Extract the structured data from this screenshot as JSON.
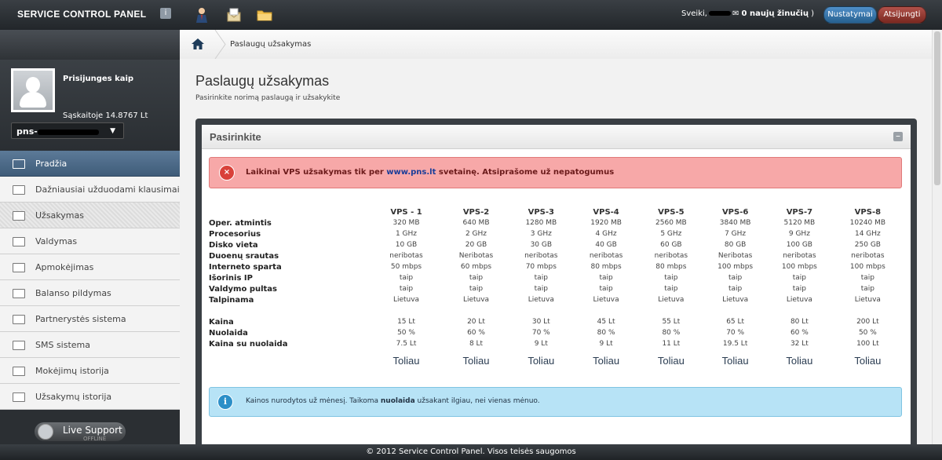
{
  "topbar": {
    "brand": "SERVICE CONTROL PANEL",
    "brand_badge": "i",
    "icons": [
      "user-icon",
      "mail-icon",
      "folder-icon"
    ],
    "greeting_prefix": "Sveiki,",
    "messages_count": "0 naujų žinučių",
    "messages_suffix": ")",
    "settings_label": "Nustatymai",
    "logout_label": "Atsijungti"
  },
  "profile": {
    "logged_as": "Prisijunges kaip",
    "balance": "Sąskaitoje 14.8767 Lt",
    "account_prefix": "pns-"
  },
  "sidebar": {
    "items": [
      {
        "label": "Pradžia",
        "active": true
      },
      {
        "label": "Dažniausiai užduodami klausimai"
      },
      {
        "label": "Užsakymas",
        "hover": true
      },
      {
        "label": "Valdymas"
      },
      {
        "label": "Apmokėjimas"
      },
      {
        "label": "Balanso pildymas"
      },
      {
        "label": "Partnerystės sistema"
      },
      {
        "label": "SMS sistema"
      },
      {
        "label": "Mokėjimų istorija"
      },
      {
        "label": "Užsakymų istorija"
      }
    ],
    "live_support": "Live Support",
    "live_support_status": "OFFLINE"
  },
  "breadcrumb": {
    "current": "Paslaugų užsakymas"
  },
  "page": {
    "title": "Paslaugų užsakymas",
    "subtitle": "Pasirinkite norimą paslaugą ir užsakykite"
  },
  "panel": {
    "title": "Pasirinkite",
    "collapse": "–"
  },
  "error_alert": {
    "icon": "×",
    "text_before": "Laikinai VPS užsakymas tik per",
    "link": "www.pns.lt",
    "text_after": "svetainę. Atsiprašome už nepatogumus"
  },
  "pricing": {
    "plans": [
      "VPS - 1",
      "VPS-2",
      "VPS-3",
      "VPS-4",
      "VPS-5",
      "VPS-6",
      "VPS-7",
      "VPS-8"
    ],
    "spec_rows": [
      {
        "label": "Oper. atmintis",
        "values": [
          "320 MB",
          "640 MB",
          "1280 MB",
          "1920 MB",
          "2560 MB",
          "3840 MB",
          "5120 MB",
          "10240 MB"
        ]
      },
      {
        "label": "Procesorius",
        "values": [
          "1 GHz",
          "2 GHz",
          "3 GHz",
          "4 GHz",
          "5 GHz",
          "7 GHz",
          "9 GHz",
          "14 GHz"
        ]
      },
      {
        "label": "Disko vieta",
        "values": [
          "10 GB",
          "20 GB",
          "30 GB",
          "40 GB",
          "60 GB",
          "80 GB",
          "100 GB",
          "250 GB"
        ]
      },
      {
        "label": "Duoenų srautas",
        "values": [
          "neribotas",
          "Neribotas",
          "neribotas",
          "neribotas",
          "neribotas",
          "Neribotas",
          "neribotas",
          "neribotas"
        ]
      },
      {
        "label": "Interneto sparta",
        "values": [
          "50 mbps",
          "60 mbps",
          "70 mbps",
          "80 mbps",
          "80 mbps",
          "100 mbps",
          "100 mbps",
          "100 mbps"
        ]
      },
      {
        "label": "Išorinis IP",
        "values": [
          "taip",
          "taip",
          "taip",
          "taip",
          "taip",
          "taip",
          "taip",
          "taip"
        ]
      },
      {
        "label": "Valdymo pultas",
        "values": [
          "taip",
          "taip",
          "taip",
          "taip",
          "taip",
          "taip",
          "taip",
          "taip"
        ]
      },
      {
        "label": "Talpinama",
        "values": [
          "Lietuva",
          "Lietuva",
          "Lietuva",
          "Lietuva",
          "Lietuva",
          "Lietuva",
          "Lietuva",
          "Lietuva"
        ]
      }
    ],
    "price_rows": [
      {
        "label": "Kaina",
        "values": [
          "15 Lt",
          "20 Lt",
          "30 Lt",
          "45 Lt",
          "55 Lt",
          "65 Lt",
          "80 Lt",
          "200 Lt"
        ]
      },
      {
        "label": "Nuolaida",
        "values": [
          "50 %",
          "60 %",
          "70 %",
          "80 %",
          "80 %",
          "70 %",
          "60 %",
          "50 %"
        ]
      },
      {
        "label": "Kaina su nuolaida",
        "values": [
          "7.5 Lt",
          "8 Lt",
          "9 Lt",
          "9 Lt",
          "11 Lt",
          "19.5 Lt",
          "32 Lt",
          "100 Lt"
        ]
      }
    ],
    "next_label": "Toliau"
  },
  "info_alert": {
    "icon": "i",
    "text_before": "Kainos nurodytos už mėnesį. Taikoma",
    "bold": "nuolaida",
    "text_after": "užsakant ilgiau, nei vienas mėnuo."
  },
  "footer": {
    "text": "© 2012 Service Control Panel. Visos teisės saugomos"
  }
}
